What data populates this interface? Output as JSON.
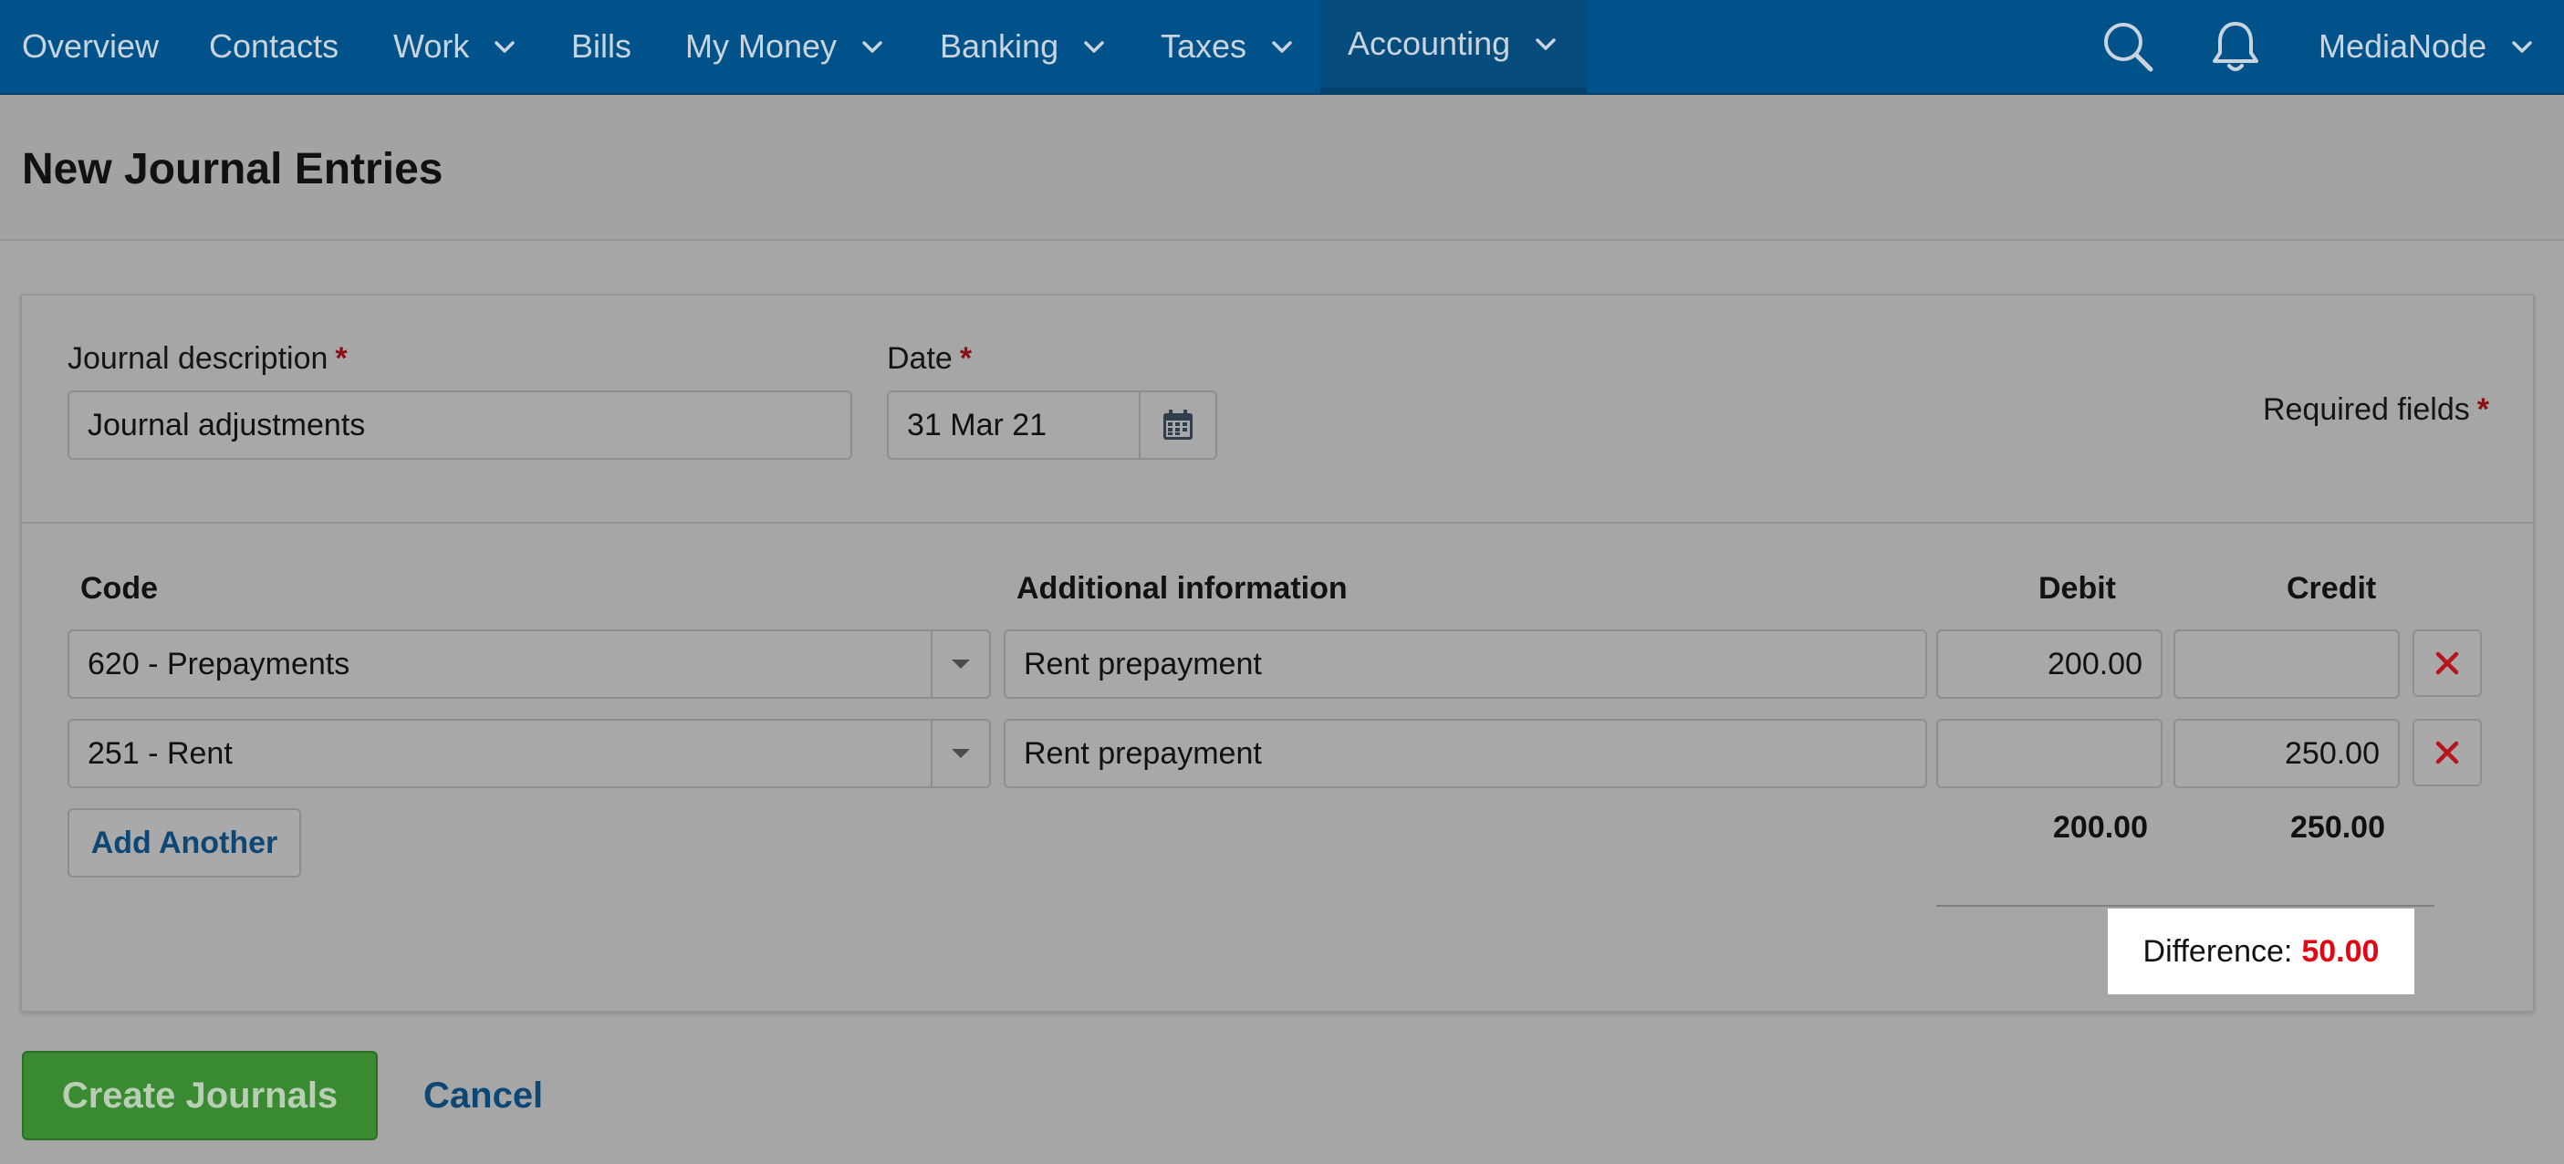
{
  "nav": {
    "items": [
      {
        "label": "Overview",
        "dropdown": false
      },
      {
        "label": "Contacts",
        "dropdown": false
      },
      {
        "label": "Work",
        "dropdown": true
      },
      {
        "label": "Bills",
        "dropdown": false
      },
      {
        "label": "My Money",
        "dropdown": true
      },
      {
        "label": "Banking",
        "dropdown": true
      },
      {
        "label": "Taxes",
        "dropdown": true
      },
      {
        "label": "Accounting",
        "dropdown": true,
        "active": true
      }
    ],
    "account_label": "MediaNode",
    "icons": [
      "search-icon",
      "bell-icon",
      "chevron-down-icon"
    ]
  },
  "page": {
    "title": "New Journal Entries"
  },
  "form": {
    "description_label": "Journal description",
    "description_value": "Journal adjustments",
    "date_label": "Date",
    "date_value": "31 Mar 21",
    "required_marker": "*",
    "required_fields_label": "Required fields"
  },
  "table": {
    "headers": {
      "code": "Code",
      "info": "Additional information",
      "debit": "Debit",
      "credit": "Credit"
    },
    "rows": [
      {
        "code": "620 - Prepayments",
        "info": "Rent prepayment",
        "debit": "200.00",
        "credit": ""
      },
      {
        "code": "251 - Rent",
        "info": "Rent prepayment",
        "debit": "",
        "credit": "250.00"
      }
    ],
    "add_label": "Add Another",
    "total_debit": "200.00",
    "total_credit": "250.00",
    "difference_label": "Difference:",
    "difference_value": "50.00"
  },
  "actions": {
    "create_label": "Create Journals",
    "cancel_label": "Cancel"
  },
  "colors": {
    "nav_bg": "#00528a",
    "accent_red": "#e30613",
    "create_green": "#3a8a32",
    "link_blue": "#0d4775"
  }
}
